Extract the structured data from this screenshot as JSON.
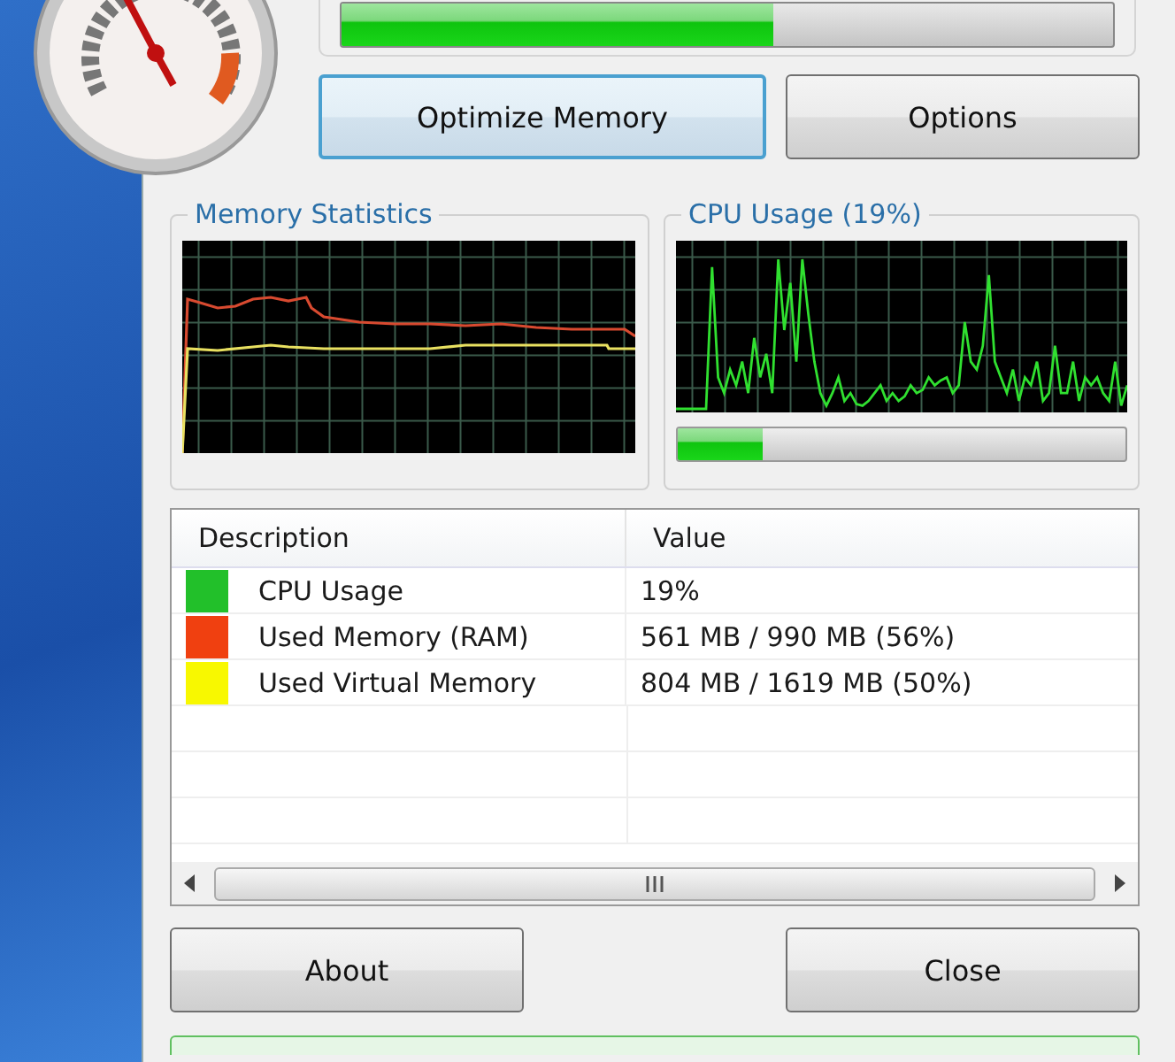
{
  "memory_bar": {
    "level": 0.56
  },
  "actions": [
    {
      "label": "Optimize Memory",
      "focused": true
    },
    {
      "label": "Options",
      "focused": false
    }
  ],
  "memory_statistics": {
    "title": "Memory Statistics"
  },
  "cpu_usage": {
    "title": "CPU Usage (19%)",
    "level": 0.19
  },
  "table": {
    "columns": [
      "Description",
      "Value"
    ],
    "rows": [
      {
        "description": "CPU Usage",
        "value": "19%",
        "color": "#22c02a"
      },
      {
        "description": "Used Memory (RAM)",
        "value": "561 MB / 990 MB (56%)",
        "color": "#f04010"
      },
      {
        "description": "Used Virtual Memory",
        "value": "804 MB / 1619 MB (50%)",
        "color": "#f8f800"
      }
    ]
  },
  "buttons": [
    "About",
    "Close"
  ]
}
